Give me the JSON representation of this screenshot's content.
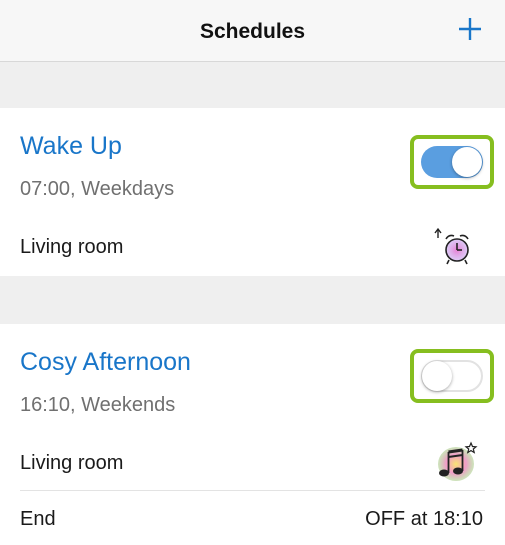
{
  "header": {
    "title": "Schedules",
    "add_icon": "plus-icon"
  },
  "schedules": [
    {
      "name": "Wake Up",
      "time_days": "07:00, Weekdays",
      "room": "Living room",
      "enabled": true,
      "icon": "alarm-clock-icon"
    },
    {
      "name": "Cosy Afternoon",
      "time_days": "16:10, Weekends",
      "room": "Living room",
      "enabled": false,
      "icon": "music-notes-icon",
      "end_label": "End",
      "end_value": "OFF at 18:10"
    }
  ],
  "colors": {
    "accent": "#1976c9",
    "toggle_on": "#5a9ee0",
    "highlight": "#86be1f"
  }
}
